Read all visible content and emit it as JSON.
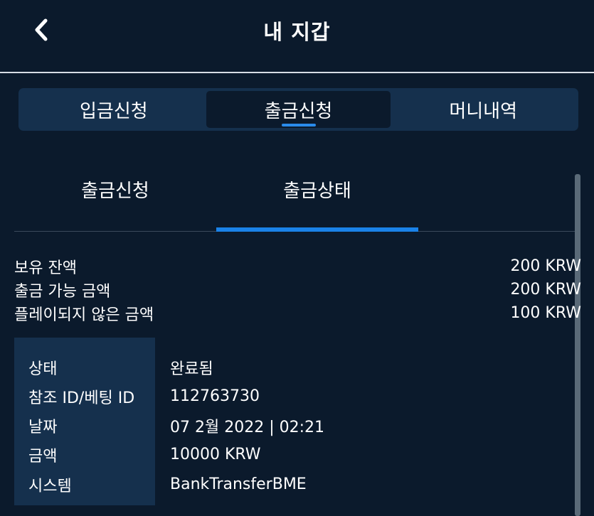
{
  "header": {
    "title": "내 지갑",
    "back_icon": "chevron-left-icon"
  },
  "tabs": [
    {
      "label": "입금신청",
      "active": false
    },
    {
      "label": "출금신청",
      "active": true
    },
    {
      "label": "머니내역",
      "active": false
    }
  ],
  "subtabs": [
    {
      "label": "출금신청",
      "active": false
    },
    {
      "label": "출금상태",
      "active": true
    }
  ],
  "balances": [
    {
      "label": "보유 잔액",
      "value": "200 KRW"
    },
    {
      "label": "출금 가능 금액",
      "value": "200 KRW"
    },
    {
      "label": "플레이되지 않은 금액",
      "value": "100 KRW"
    }
  ],
  "details": [
    {
      "label": "상태",
      "value": "완료됨"
    },
    {
      "label": "참조 ID/베팅 ID",
      "value": "112763730"
    },
    {
      "label": "날짜",
      "value": "07 2월 2022 | 02:21"
    },
    {
      "label": "금액",
      "value": "10000 KRW"
    },
    {
      "label": "시스템",
      "value": "BankTransferBME"
    }
  ],
  "colors": {
    "background": "#0b1a2c",
    "panel": "#15304d",
    "accent": "#1a82e8"
  }
}
